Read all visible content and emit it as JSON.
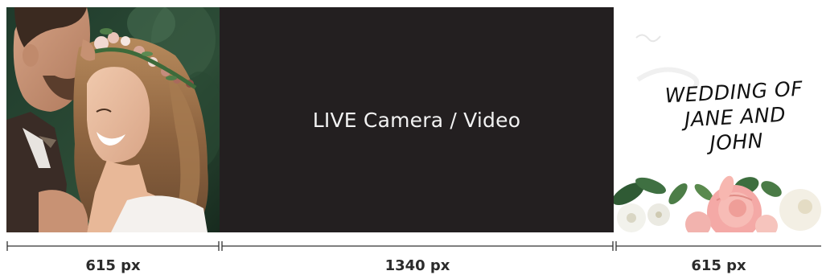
{
  "panels": {
    "left": {
      "image": "wedding-couple-photo",
      "width_label": "615 px"
    },
    "center": {
      "label": "LIVE Camera / Video",
      "background": "#231f20",
      "width_label": "1340 px"
    },
    "right": {
      "image": "floral-wedding-card",
      "title_line1": "WEDDING OF",
      "title_line2": "JANE AND JOHN",
      "width_label": "615 px"
    }
  }
}
